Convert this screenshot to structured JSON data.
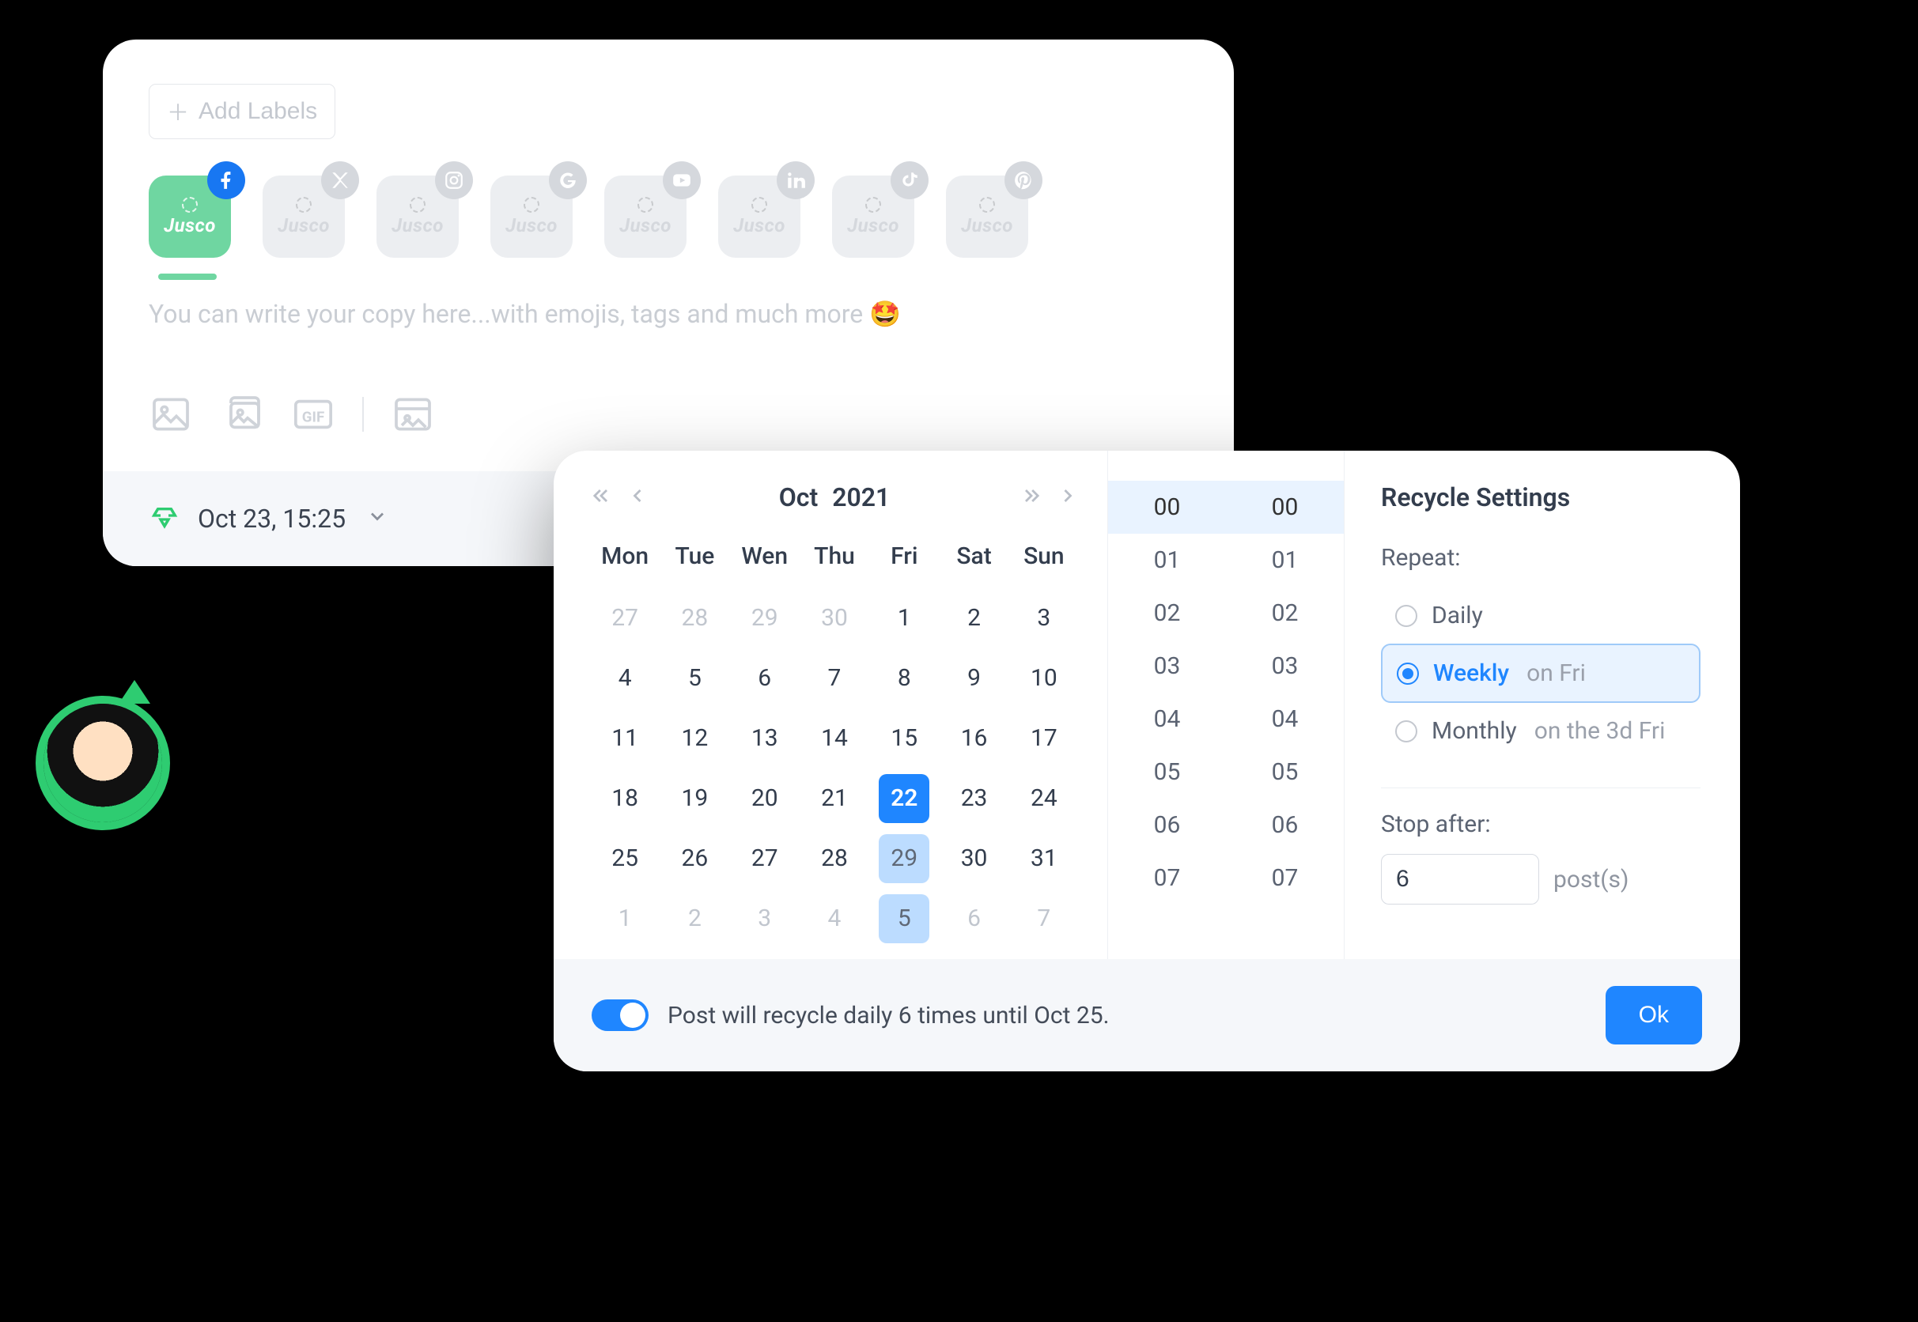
{
  "composer": {
    "add_labels_label": "Add Labels",
    "accounts": [
      {
        "brand": "Jusco",
        "net": "facebook",
        "active": true
      },
      {
        "brand": "Jusco",
        "net": "x",
        "active": false
      },
      {
        "brand": "Jusco",
        "net": "instagram",
        "active": false
      },
      {
        "brand": "Jusco",
        "net": "google",
        "active": false
      },
      {
        "brand": "Jusco",
        "net": "youtube",
        "active": false
      },
      {
        "brand": "Jusco",
        "net": "linkedin",
        "active": false
      },
      {
        "brand": "Jusco",
        "net": "tiktok",
        "active": false
      },
      {
        "brand": "Jusco",
        "net": "pinterest",
        "active": false
      }
    ],
    "placeholder": "You can write your copy here...with emojis, tags and much more 🤩",
    "schedule_label": "Oct 23, 15:25"
  },
  "scheduler": {
    "month": "Oct",
    "year": "2021",
    "dow": [
      "Mon",
      "Tue",
      "Wen",
      "Thu",
      "Fri",
      "Sat",
      "Sun"
    ],
    "weeks": [
      [
        {
          "n": "27",
          "out": true
        },
        {
          "n": "28",
          "out": true
        },
        {
          "n": "29",
          "out": true
        },
        {
          "n": "30",
          "out": true
        },
        {
          "n": "1"
        },
        {
          "n": "2"
        },
        {
          "n": "3"
        }
      ],
      [
        {
          "n": "4"
        },
        {
          "n": "5"
        },
        {
          "n": "6"
        },
        {
          "n": "7"
        },
        {
          "n": "8"
        },
        {
          "n": "9"
        },
        {
          "n": "10"
        }
      ],
      [
        {
          "n": "11"
        },
        {
          "n": "12"
        },
        {
          "n": "13"
        },
        {
          "n": "14"
        },
        {
          "n": "15"
        },
        {
          "n": "16"
        },
        {
          "n": "17"
        }
      ],
      [
        {
          "n": "18"
        },
        {
          "n": "19"
        },
        {
          "n": "20"
        },
        {
          "n": "21"
        },
        {
          "n": "22",
          "sel": true
        },
        {
          "n": "23"
        },
        {
          "n": "24"
        }
      ],
      [
        {
          "n": "25"
        },
        {
          "n": "26"
        },
        {
          "n": "27"
        },
        {
          "n": "28"
        },
        {
          "n": "29",
          "hl": true
        },
        {
          "n": "30"
        },
        {
          "n": "31"
        }
      ],
      [
        {
          "n": "1",
          "out": true
        },
        {
          "n": "2",
          "out": true
        },
        {
          "n": "3",
          "out": true
        },
        {
          "n": "4",
          "out": true
        },
        {
          "n": "5",
          "hl": true
        },
        {
          "n": "6",
          "out": true
        },
        {
          "n": "7",
          "out": true
        }
      ]
    ],
    "hours": [
      "00",
      "01",
      "02",
      "03",
      "04",
      "05",
      "06",
      "07"
    ],
    "minutes": [
      "00",
      "01",
      "02",
      "03",
      "04",
      "05",
      "06",
      "07"
    ],
    "hour_selected": "00",
    "minute_selected": "00",
    "settings_title": "Recycle Settings",
    "repeat_label": "Repeat:",
    "repeat_options": [
      {
        "label": "Daily",
        "suffix": "",
        "selected": false
      },
      {
        "label": "Weekly",
        "suffix": "on Fri",
        "selected": true
      },
      {
        "label": "Monthly",
        "suffix": "on the 3d Fri",
        "selected": false
      }
    ],
    "stop_label": "Stop after:",
    "stop_value": "6",
    "stop_suffix": "post(s)",
    "footer_text": "Post will recycle daily 6 times until Oct 25.",
    "ok_label": "Ok"
  }
}
